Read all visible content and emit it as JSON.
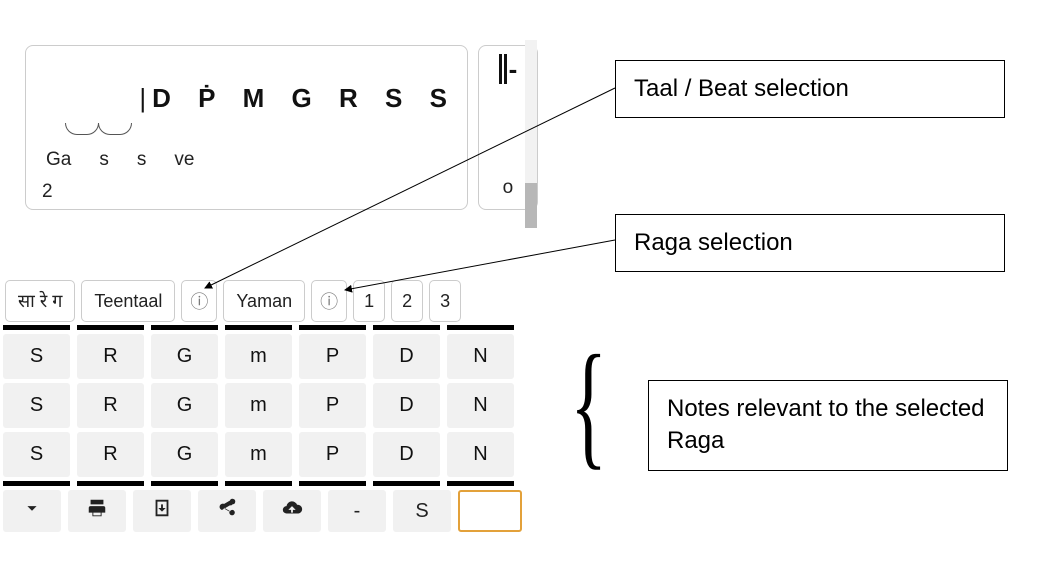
{
  "notation": {
    "notes_display": "D Ṗ M G R S S",
    "lyrics": [
      "Ga",
      "s",
      "s",
      "ve"
    ],
    "beat_number": "2",
    "terminator_symbol": "o"
  },
  "selectors": {
    "script_label": "सा रे ग",
    "taal": "Teentaal",
    "raga": "Yaman",
    "info_icon": "info-icon",
    "numbers": [
      "1",
      "2",
      "3"
    ]
  },
  "note_grid": {
    "rows": [
      [
        "S",
        "R",
        "G",
        "m",
        "P",
        "D",
        "N"
      ],
      [
        "S",
        "R",
        "G",
        "m",
        "P",
        "D",
        "N"
      ],
      [
        "S",
        "R",
        "G",
        "m",
        "P",
        "D",
        "N"
      ]
    ]
  },
  "footer": {
    "icons": [
      "chevron-down-icon",
      "print-icon",
      "import-icon",
      "share-icon",
      "cloud-upload-icon"
    ],
    "dash": "-",
    "s_label": "S",
    "highlight": ""
  },
  "annotations": {
    "taal_label": "Taal / Beat selection",
    "raga_label": "Raga selection",
    "notes_label": "Notes relevant to the selected Raga"
  }
}
